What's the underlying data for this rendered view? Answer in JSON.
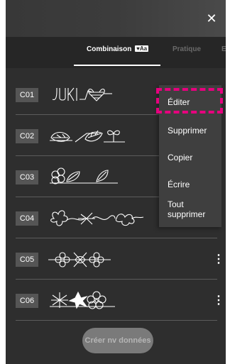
{
  "header": {
    "close_label": "✕"
  },
  "tabs": [
    {
      "label": "Combinaison",
      "badge": "Aa"
    },
    {
      "label": "Pratique"
    },
    {
      "label": "E"
    }
  ],
  "rows": [
    {
      "label": "C01",
      "pattern": "juki-heart"
    },
    {
      "label": "C02",
      "pattern": "leaves-sprout"
    },
    {
      "label": "C03",
      "pattern": "flower-leaves"
    },
    {
      "label": "C04",
      "pattern": "floral-vine"
    },
    {
      "label": "C05",
      "pattern": "flower-border"
    },
    {
      "label": "C06",
      "pattern": "star-flowers"
    }
  ],
  "context_menu": {
    "items": [
      "Éditer",
      "Supprimer",
      "Copier",
      "Écrire",
      "Tout supprimer"
    ]
  },
  "more_icon": "⋮",
  "create_button": "Créer nv données",
  "highlight_color": "#e6007e"
}
